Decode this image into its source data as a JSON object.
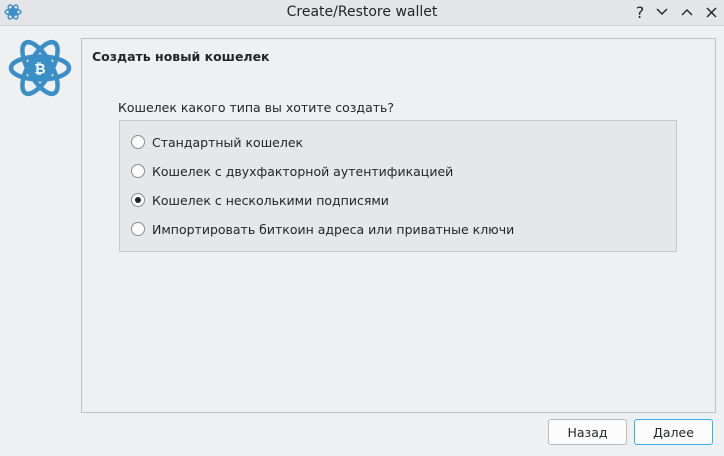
{
  "window": {
    "title": "Create/Restore wallet",
    "controls": {
      "help": "?",
      "minimize": "chevron-down-icon",
      "maximize": "chevron-up-icon",
      "close": "close-icon"
    }
  },
  "wizard": {
    "heading": "Создать новый кошелек",
    "question": "Кошелек какого типа вы хотите создать?",
    "options": [
      {
        "label": "Стандартный кошелек",
        "checked": false
      },
      {
        "label": "Кошелек с двухфакторной аутентификацией",
        "checked": false
      },
      {
        "label": "Кошелек с несколькими подписями",
        "checked": true
      },
      {
        "label": "Импортировать биткоин адреса или приватные ключи",
        "checked": false
      }
    ]
  },
  "buttons": {
    "back": "Назад",
    "next": "Далее"
  },
  "colors": {
    "accent": "#3daee9",
    "logo": "#3b8fc7"
  }
}
